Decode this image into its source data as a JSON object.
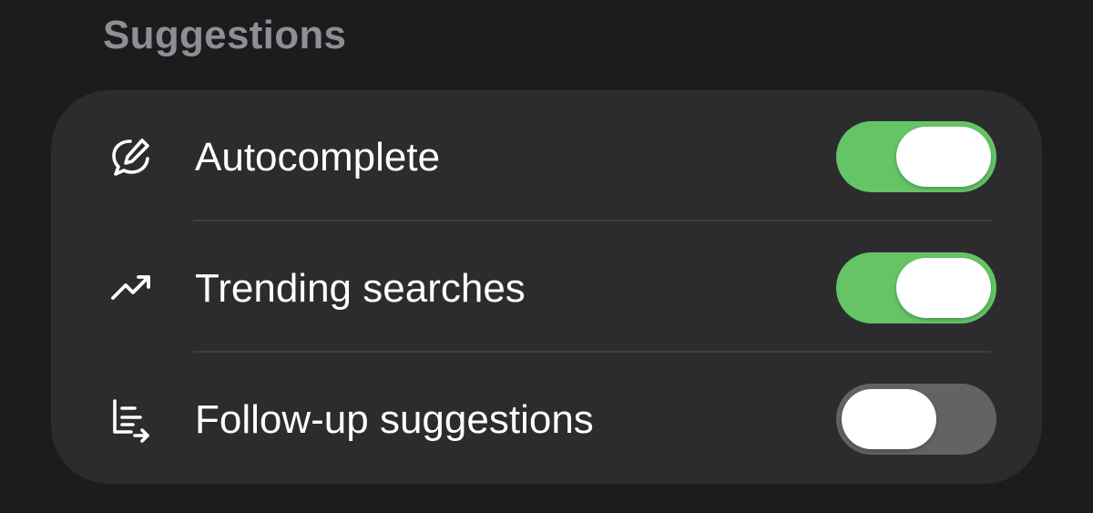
{
  "section": {
    "title": "Suggestions"
  },
  "colors": {
    "toggle_on": "#65c466",
    "toggle_off": "#636366"
  },
  "rows": [
    {
      "label": "Autocomplete",
      "icon": "autocomplete-icon",
      "enabled": true
    },
    {
      "label": "Trending searches",
      "icon": "trending-up-icon",
      "enabled": true
    },
    {
      "label": "Follow-up suggestions",
      "icon": "follow-up-icon",
      "enabled": false
    }
  ]
}
